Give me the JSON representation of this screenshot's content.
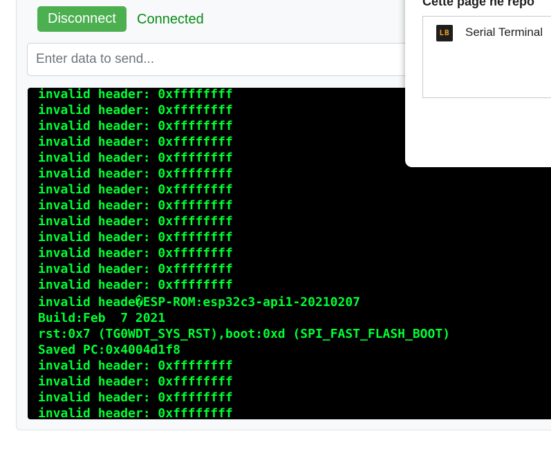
{
  "controls": {
    "disconnect_label": "Disconnect",
    "status_text": "Connected"
  },
  "send": {
    "placeholder": "Enter data to send...",
    "value": ""
  },
  "terminal": {
    "lines": [
      "invalid header: 0xffffffff",
      "invalid header: 0xffffffff",
      "invalid header: 0xffffffff",
      "invalid header: 0xffffffff",
      "invalid header: 0xffffffff",
      "invalid header: 0xffffffff",
      "invalid header: 0xffffffff",
      "invalid header: 0xffffffff",
      "invalid header: 0xffffffff",
      "invalid header: 0xffffffff",
      "invalid header: 0xffffffff",
      "invalid header: 0xffffffff",
      "invalid header: 0xffffffff",
      "invalid heade�ESP-ROM:esp32c3-api1-20210207",
      "Build:Feb  7 2021",
      "rst:0x7 (TG0WDT_SYS_RST),boot:0xd (SPI_FAST_FLASH_BOOT)",
      "Saved PC:0x4004d1f8",
      "invalid header: 0xffffffff",
      "invalid header: 0xffffffff",
      "invalid header: 0xffffffff",
      "invalid header: 0xffffffff"
    ],
    "text_color": "#00ff33",
    "background": "#000000"
  },
  "popup": {
    "title": "Cette page ne répo",
    "items": [
      {
        "icon": "LB",
        "icon_name": "lb-app-icon",
        "label": "Serial Terminal"
      }
    ]
  },
  "colors": {
    "button_green": "#4caf50",
    "status_green": "#0a8a16"
  }
}
